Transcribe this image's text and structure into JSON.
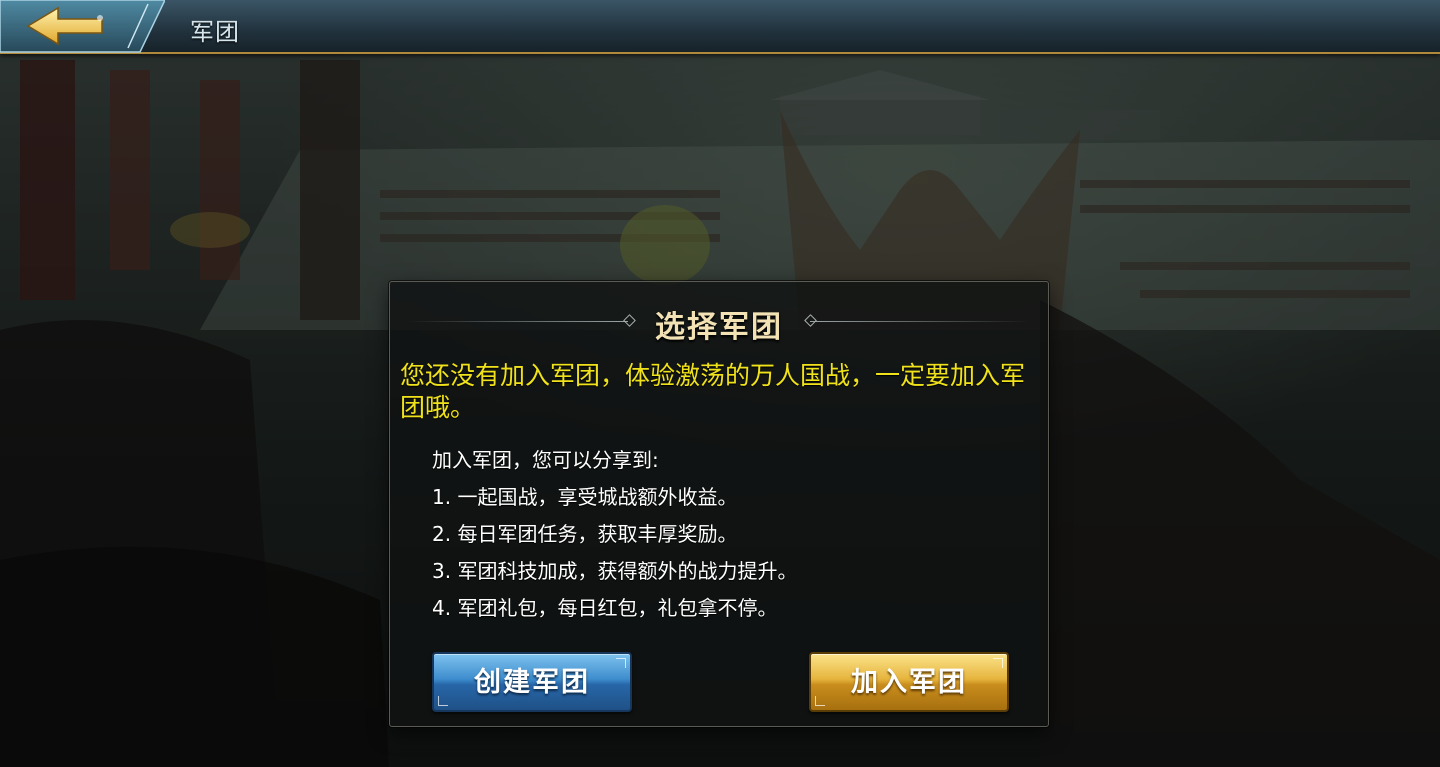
{
  "header": {
    "title": "军团",
    "back_icon": "back-arrow-icon"
  },
  "dialog": {
    "title": "选择军团",
    "intro": "您还没有加入军团，体验激荡的万人国战，一定要加入军团哦。",
    "benefits_heading": "加入军团，您可以分享到:",
    "benefits": [
      "1. 一起国战，享受城战额外收益。",
      "2. 每日军团任务，获取丰厚奖励。",
      "3. 军团科技加成，获得额外的战力提升。",
      "4. 军团礼包，每日红包，礼包拿不停。"
    ],
    "create_label": "创建军团",
    "join_label": "加入军团"
  },
  "colors": {
    "intro_text": "#f0e21a",
    "title_text": "#f3e2b4",
    "create_button": "#3d8ccd",
    "join_button": "#e6b43d"
  }
}
